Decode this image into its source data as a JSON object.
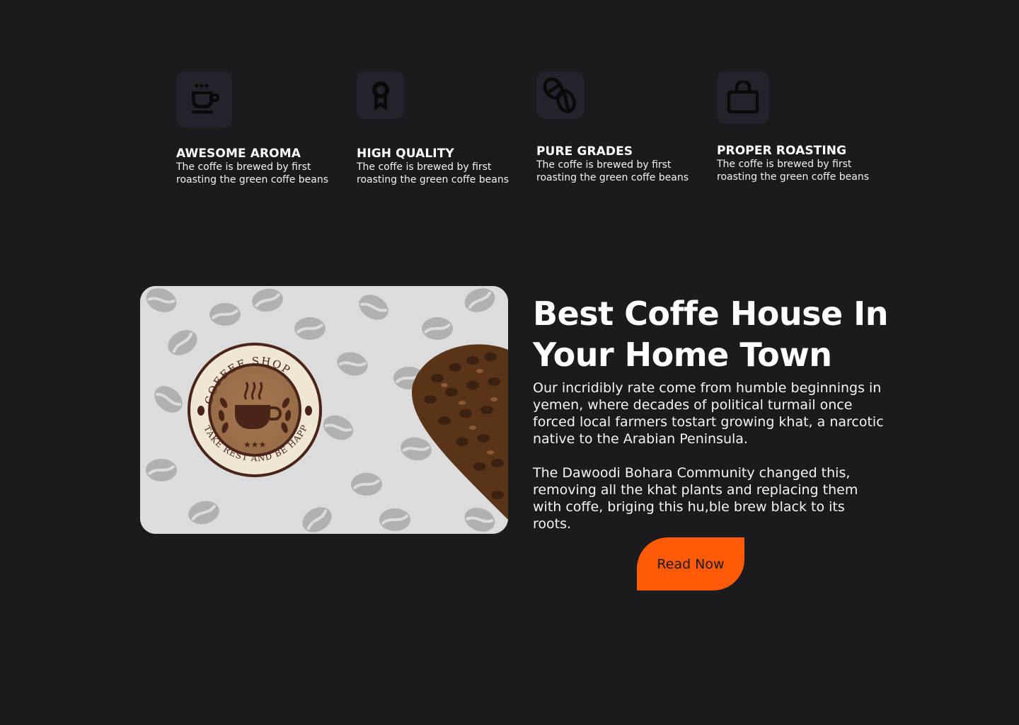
{
  "features": [
    {
      "icon": "coffee-cup-icon",
      "title": "AWESOME AROMA",
      "desc": "The coffe is brewed by first roasting the green coffe beans"
    },
    {
      "icon": "award-ribbon-icon",
      "title": "HIGH QUALITY",
      "desc": "The coffe is brewed by first roasting the green coffe beans"
    },
    {
      "icon": "coffee-beans-icon",
      "title": "PURE GRADES",
      "desc": "The coffe is brewed by first roasting the green coffe beans"
    },
    {
      "icon": "shopping-bag-icon",
      "title": "PROPER ROASTING",
      "desc": "The coffe is brewed by first roasting the green coffe beans"
    }
  ],
  "hero": {
    "image": {
      "badge_top_text": "COFFEE SHOP",
      "badge_bottom_text": "TAKE REST AND BE HAPPY"
    },
    "heading_line1": "Best Coffe House In",
    "heading_line2": "Your Home Town",
    "paragraph1": "Our incridibly rate come from humble beginnings in yemen, where decades of political turmail once forced local farmers tostart growing khat, a narcotic native to the Arabian Peninsula.",
    "paragraph2": "The Dawoodi Bohara Community changed this, removing all the khat plants and replacing them with coffe, briging this hu,ble brew black to its roots.",
    "button_label": "Read Now"
  },
  "colors": {
    "background": "#1b1b1d",
    "icon_tile": "#23232b",
    "accent": "#ff5a07",
    "text": "#ffffff"
  }
}
